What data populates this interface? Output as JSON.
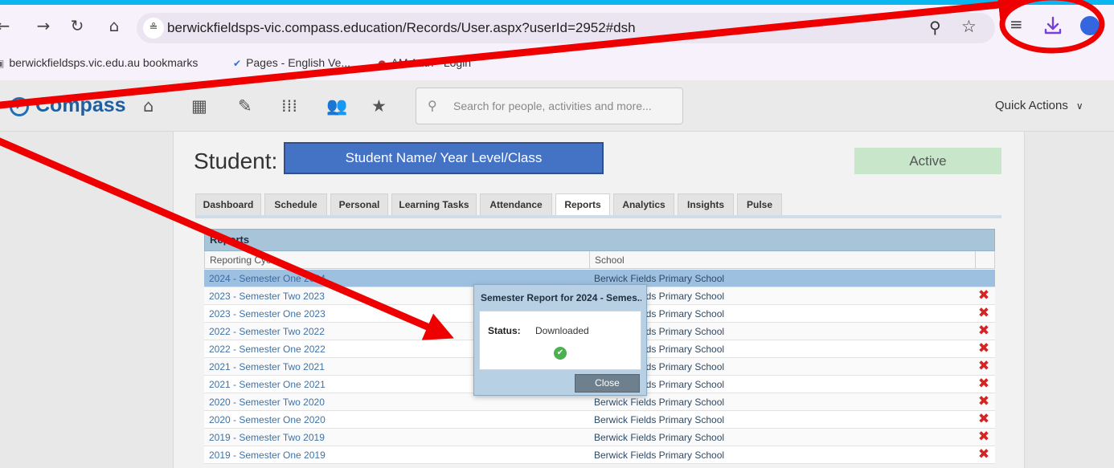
{
  "browser": {
    "url": "berwickfieldsps-vic.compass.education/Records/User.aspx?userId=2952#dsh",
    "bookmarks": [
      {
        "label": "berwickfieldsps.vic.edu.au bookmarks"
      },
      {
        "label": "Pages - English Ve..."
      },
      {
        "label": "AM Auth - Login"
      }
    ]
  },
  "compass": {
    "logo": "Compass",
    "search_placeholder": "Search for people, activities and more...",
    "quick_actions": "Quick Actions"
  },
  "student": {
    "label": "Student:",
    "name_placeholder": "Student Name/ Year Level/Class",
    "status": "Active"
  },
  "tabs": [
    "Dashboard",
    "Schedule",
    "Personal",
    "Learning Tasks",
    "Attendance",
    "Reports",
    "Analytics",
    "Insights",
    "Pulse"
  ],
  "active_tab": "Reports",
  "reports": {
    "heading": "Reports",
    "col_cycle": "Reporting Cycle",
    "col_school": "School",
    "rows": [
      {
        "cycle": "2024 - Semester One 2024",
        "school": "Berwick Fields Primary School"
      },
      {
        "cycle": "2023 - Semester Two 2023",
        "school": "Berwick Fields Primary School"
      },
      {
        "cycle": "2023 - Semester One 2023",
        "school": "Berwick Fields Primary School"
      },
      {
        "cycle": "2022 - Semester Two 2022",
        "school": "Berwick Fields Primary School"
      },
      {
        "cycle": "2022 - Semester One 2022",
        "school": "Berwick Fields Primary School"
      },
      {
        "cycle": "2021 - Semester Two 2021",
        "school": "Berwick Fields Primary School"
      },
      {
        "cycle": "2021 - Semester One 2021",
        "school": "Berwick Fields Primary School"
      },
      {
        "cycle": "2020 - Semester Two 2020",
        "school": "Berwick Fields Primary School"
      },
      {
        "cycle": "2020 - Semester One 2020",
        "school": "Berwick Fields Primary School"
      },
      {
        "cycle": "2019 - Semester Two 2019",
        "school": "Berwick Fields Primary School"
      },
      {
        "cycle": "2019 - Semester One 2019",
        "school": "Berwick Fields Primary School"
      }
    ]
  },
  "dialog": {
    "title": "Semester Report for 2024 - Semes...",
    "status_label": "Status:",
    "status_value": "Downloaded",
    "close_label": "Close"
  },
  "colors": {
    "annotation": "#ee0000",
    "background": "#09b6ef"
  }
}
